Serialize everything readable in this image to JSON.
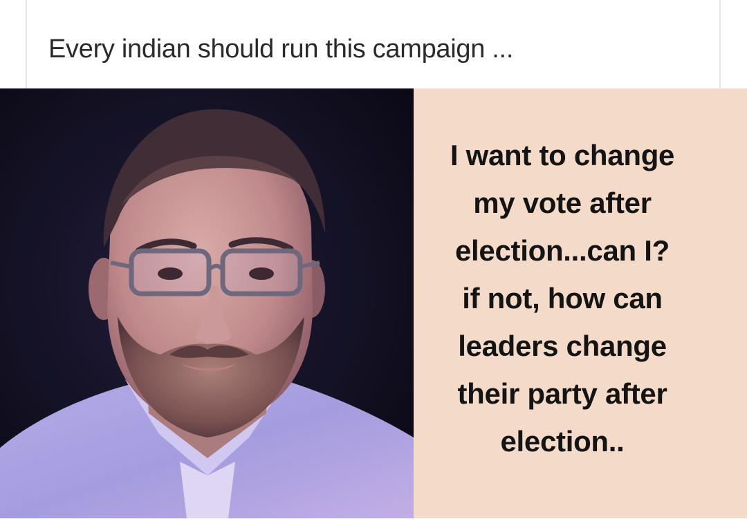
{
  "post": {
    "caption": "Every indian should run this campaign ..."
  },
  "meme": {
    "photo": {
      "icon": "portrait-photo",
      "background_color": "#06060a"
    },
    "panel_color": "#f3dac9",
    "quote_lines": [
      "I want to change",
      "my vote after",
      "election...can I?",
      "if not, how can",
      "leaders change",
      "their party after",
      "election.."
    ]
  }
}
